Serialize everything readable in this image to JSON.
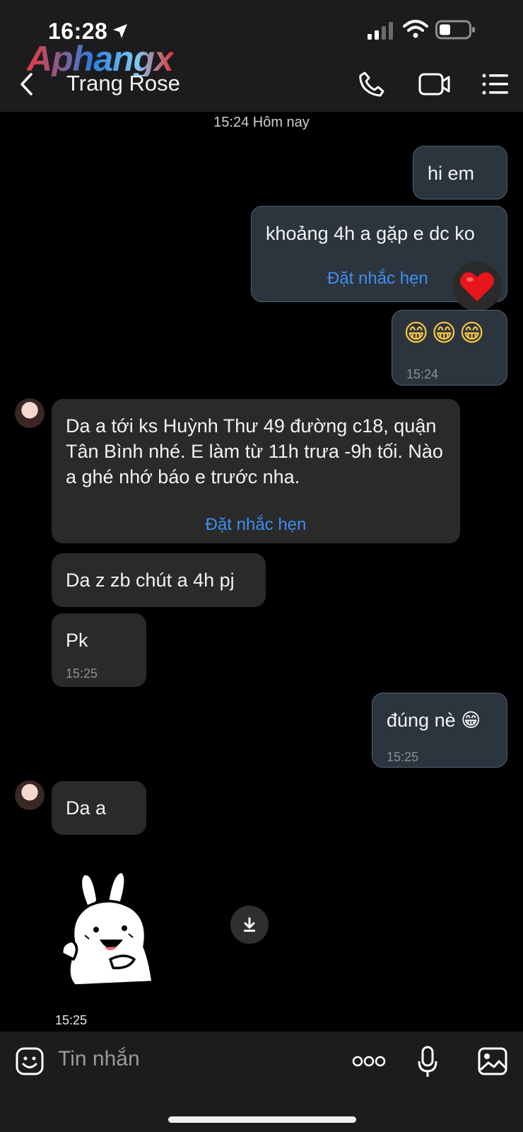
{
  "status": {
    "time": "16:28"
  },
  "watermark": "Aphangx",
  "header": {
    "title": "Trang Rose"
  },
  "date_label": "15:24 Hôm nay",
  "messages": {
    "m1": "hi em",
    "m2": "khoảng 4h a gặp e dc ko",
    "m2_remind": "Đặt nhắc hẹn",
    "m3_emoji": "😁😁😁",
    "m3_time": "15:24",
    "m4": "Da a tới ks Huỳnh Thư 49 đường c18, quận Tân Bình nhé. E làm từ 11h trưa -9h tối. Nào a ghé nhớ báo e trước nha.",
    "m4_remind": "Đặt nhắc hẹn",
    "m5": "Da z zb chút a 4h pj",
    "m6": "Pk",
    "m6_time": "15:25",
    "m7": "đúng nè 😁",
    "m7_time": "15:25",
    "m8": "Da a",
    "sticker_time": "15:25"
  },
  "reaction_emoji": "❤️",
  "input": {
    "placeholder": "Tin nhắn"
  },
  "colors": {
    "bubble_out": "#2c343d",
    "bubble_in": "#2a2a2a",
    "link": "#3e8ef0",
    "header": "#1c1c1e"
  },
  "icons": [
    "navigation-arrow-icon",
    "signal-icon",
    "wifi-icon",
    "battery-icon",
    "back-icon",
    "phone-icon",
    "video-icon",
    "menu-icon",
    "download-icon",
    "emoji-icon",
    "more-icon",
    "mic-icon",
    "image-icon"
  ]
}
